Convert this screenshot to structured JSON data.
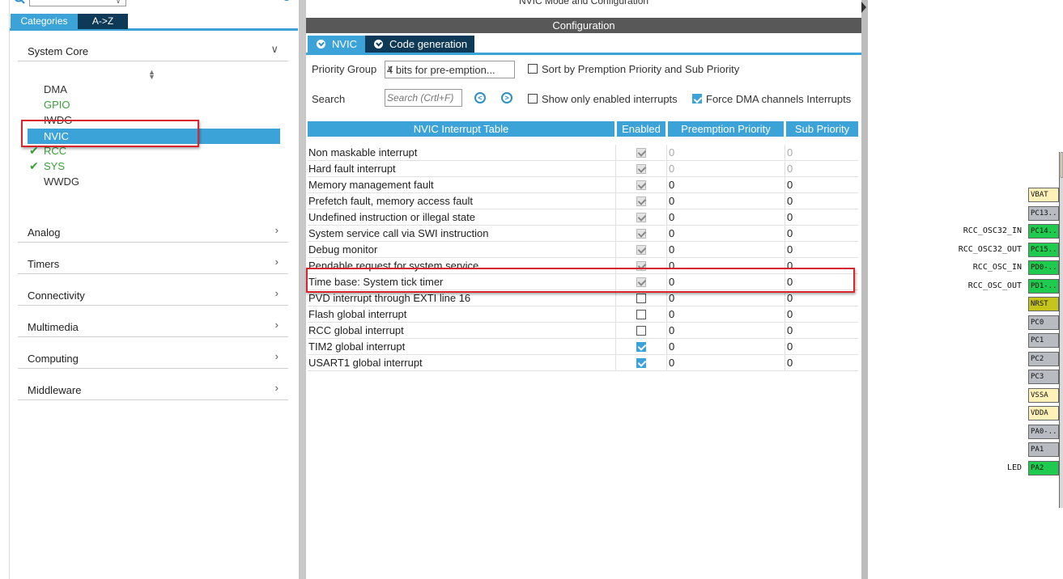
{
  "left_panel": {
    "tabs": {
      "categories": "Categories",
      "az": "A->Z"
    },
    "system_core": {
      "label": "System Core",
      "items": [
        {
          "label": "DMA",
          "state": "plain"
        },
        {
          "label": "GPIO",
          "state": "green"
        },
        {
          "label": "IWDG",
          "state": "plain"
        },
        {
          "label": "NVIC",
          "state": "selected"
        },
        {
          "label": "RCC",
          "state": "checked"
        },
        {
          "label": "SYS",
          "state": "checked"
        },
        {
          "label": "WWDG",
          "state": "plain"
        }
      ]
    },
    "categories": [
      "Analog",
      "Timers",
      "Connectivity",
      "Multimedia",
      "Computing",
      "Middleware"
    ]
  },
  "main": {
    "mode_title": "NVIC Mode and Configuration",
    "config_header": "Configuration",
    "tabs": {
      "nvic": "NVIC",
      "code_generation": "Code generation"
    },
    "priority_group_label": "Priority Group",
    "priority_group_value": "4 bits for pre-emption...",
    "sort_label": "Sort by Premption Priority and Sub Priority",
    "search_label": "Search",
    "search_placeholder": "Search (Crtl+F)",
    "show_enabled_label": "Show only enabled interrupts",
    "force_dma_label": "Force DMA channels Interrupts",
    "force_dma_checked": true,
    "table": {
      "headers": [
        "NVIC Interrupt Table",
        "Enabled",
        "Preemption Priority",
        "Sub Priority"
      ],
      "rows": [
        {
          "name": "Non maskable interrupt",
          "enabled": "locked",
          "pre": "0",
          "sub": "0",
          "grey": true
        },
        {
          "name": "Hard fault interrupt",
          "enabled": "locked",
          "pre": "0",
          "sub": "0",
          "grey": true
        },
        {
          "name": "Memory management fault",
          "enabled": "locked",
          "pre": "0",
          "sub": "0",
          "grey": false
        },
        {
          "name": "Prefetch fault, memory access fault",
          "enabled": "locked",
          "pre": "0",
          "sub": "0",
          "grey": false
        },
        {
          "name": "Undefined instruction or illegal state",
          "enabled": "locked",
          "pre": "0",
          "sub": "0",
          "grey": false
        },
        {
          "name": "System service call via SWI instruction",
          "enabled": "locked",
          "pre": "0",
          "sub": "0",
          "grey": false
        },
        {
          "name": "Debug monitor",
          "enabled": "locked",
          "pre": "0",
          "sub": "0",
          "grey": false
        },
        {
          "name": "Pendable request for system service",
          "enabled": "locked",
          "pre": "0",
          "sub": "0",
          "grey": false
        },
        {
          "name": "Time base: System tick timer",
          "enabled": "locked",
          "pre": "0",
          "sub": "0",
          "grey": false
        },
        {
          "name": "PVD interrupt through EXTI line 16",
          "enabled": "off",
          "pre": "0",
          "sub": "0",
          "grey": false
        },
        {
          "name": "Flash global interrupt",
          "enabled": "off",
          "pre": "0",
          "sub": "0",
          "grey": false
        },
        {
          "name": "RCC global interrupt",
          "enabled": "off",
          "pre": "0",
          "sub": "0",
          "grey": false
        },
        {
          "name": "TIM2 global interrupt",
          "enabled": "on",
          "pre": "0",
          "sub": "0",
          "grey": false
        },
        {
          "name": "USART1 global interrupt",
          "enabled": "on",
          "pre": "0",
          "sub": "0",
          "grey": false
        }
      ]
    }
  },
  "pinout": {
    "pins": [
      {
        "label": "VBAT",
        "color": "yellow",
        "signal": ""
      },
      {
        "label": "PC13..",
        "color": "gray",
        "signal": ""
      },
      {
        "label": "PC14..",
        "color": "green",
        "signal": "RCC_OSC32_IN"
      },
      {
        "label": "PC15..",
        "color": "green",
        "signal": "RCC_OSC32_OUT"
      },
      {
        "label": "PD0-..",
        "color": "green",
        "signal": "RCC_OSC_IN"
      },
      {
        "label": "PD1-..",
        "color": "green",
        "signal": "RCC_OSC_OUT"
      },
      {
        "label": "NRST",
        "color": "olive",
        "signal": ""
      },
      {
        "label": "PC0",
        "color": "gray",
        "signal": ""
      },
      {
        "label": "PC1",
        "color": "gray",
        "signal": ""
      },
      {
        "label": "PC2",
        "color": "gray",
        "signal": ""
      },
      {
        "label": "PC3",
        "color": "gray",
        "signal": ""
      },
      {
        "label": "VSSA",
        "color": "yellow",
        "signal": ""
      },
      {
        "label": "VDDA",
        "color": "yellow",
        "signal": ""
      },
      {
        "label": "PA0-..",
        "color": "gray",
        "signal": ""
      },
      {
        "label": "PA1",
        "color": "gray",
        "signal": ""
      },
      {
        "label": "PA2",
        "color": "green",
        "signal": "LED"
      }
    ],
    "colors": {
      "green": "#1fcb4f",
      "gray": "#b8bcc2",
      "yellow": "#fff1b8",
      "olive": "#c4c41a"
    }
  },
  "theme": {
    "accent": "#3ba3d8",
    "dark_tab": "#0e3a57",
    "highlight_box": "#d8262c",
    "ok_green": "#3aa03a"
  }
}
